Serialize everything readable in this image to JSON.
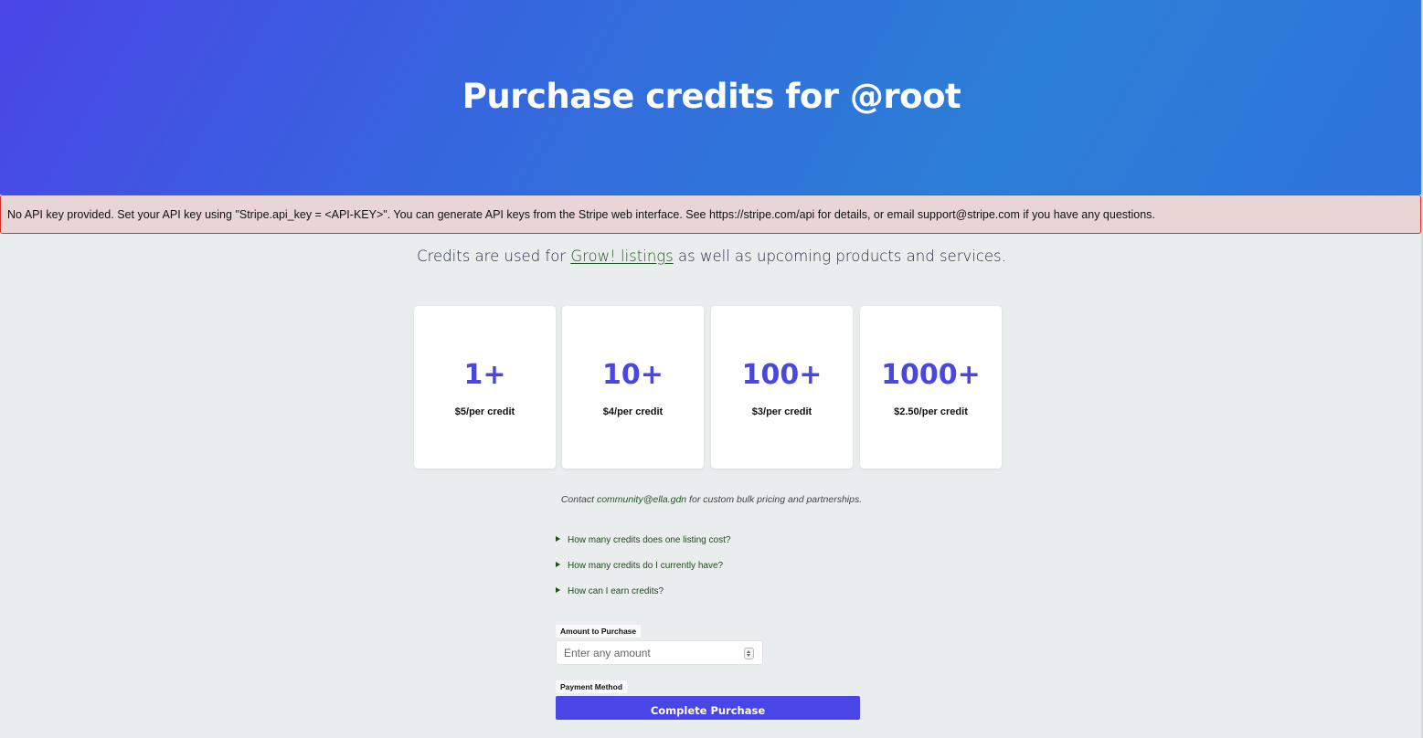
{
  "header": {
    "title": "Purchase credits for @root"
  },
  "alert": {
    "message": "No API key provided. Set your API key using \"Stripe.api_key = <API-KEY>\". You can generate API keys from the Stripe web interface. See https://stripe.com/api for details, or email support@stripe.com if you have any questions."
  },
  "intro": {
    "prefix": "Credits are used for ",
    "link_label": "Grow! listings",
    "suffix": " as well as upcoming products and services."
  },
  "tiers": [
    {
      "quantity": "1+",
      "price": "$5/per credit"
    },
    {
      "quantity": "10+",
      "price": "$4/per credit"
    },
    {
      "quantity": "100+",
      "price": "$3/per credit"
    },
    {
      "quantity": "1000+",
      "price": "$2.50/per credit"
    }
  ],
  "contact": {
    "prefix": "Contact ",
    "email": "community@ella.gdn",
    "suffix": " for custom bulk pricing and partnerships."
  },
  "faq": [
    {
      "question": "How many credits does one listing cost?"
    },
    {
      "question": "How many credits do I currently have?"
    },
    {
      "question": "How can I earn credits?"
    }
  ],
  "form": {
    "amount_label": "Amount to Purchase",
    "amount_placeholder": "Enter any amount",
    "amount_value": "",
    "payment_label": "Payment Method",
    "submit_label": "Complete Purchase"
  },
  "colors": {
    "accent": "#4a45e6",
    "alert_border": "#d9302c",
    "alert_background": "#ead5d6",
    "link": "#1e5a1e"
  }
}
